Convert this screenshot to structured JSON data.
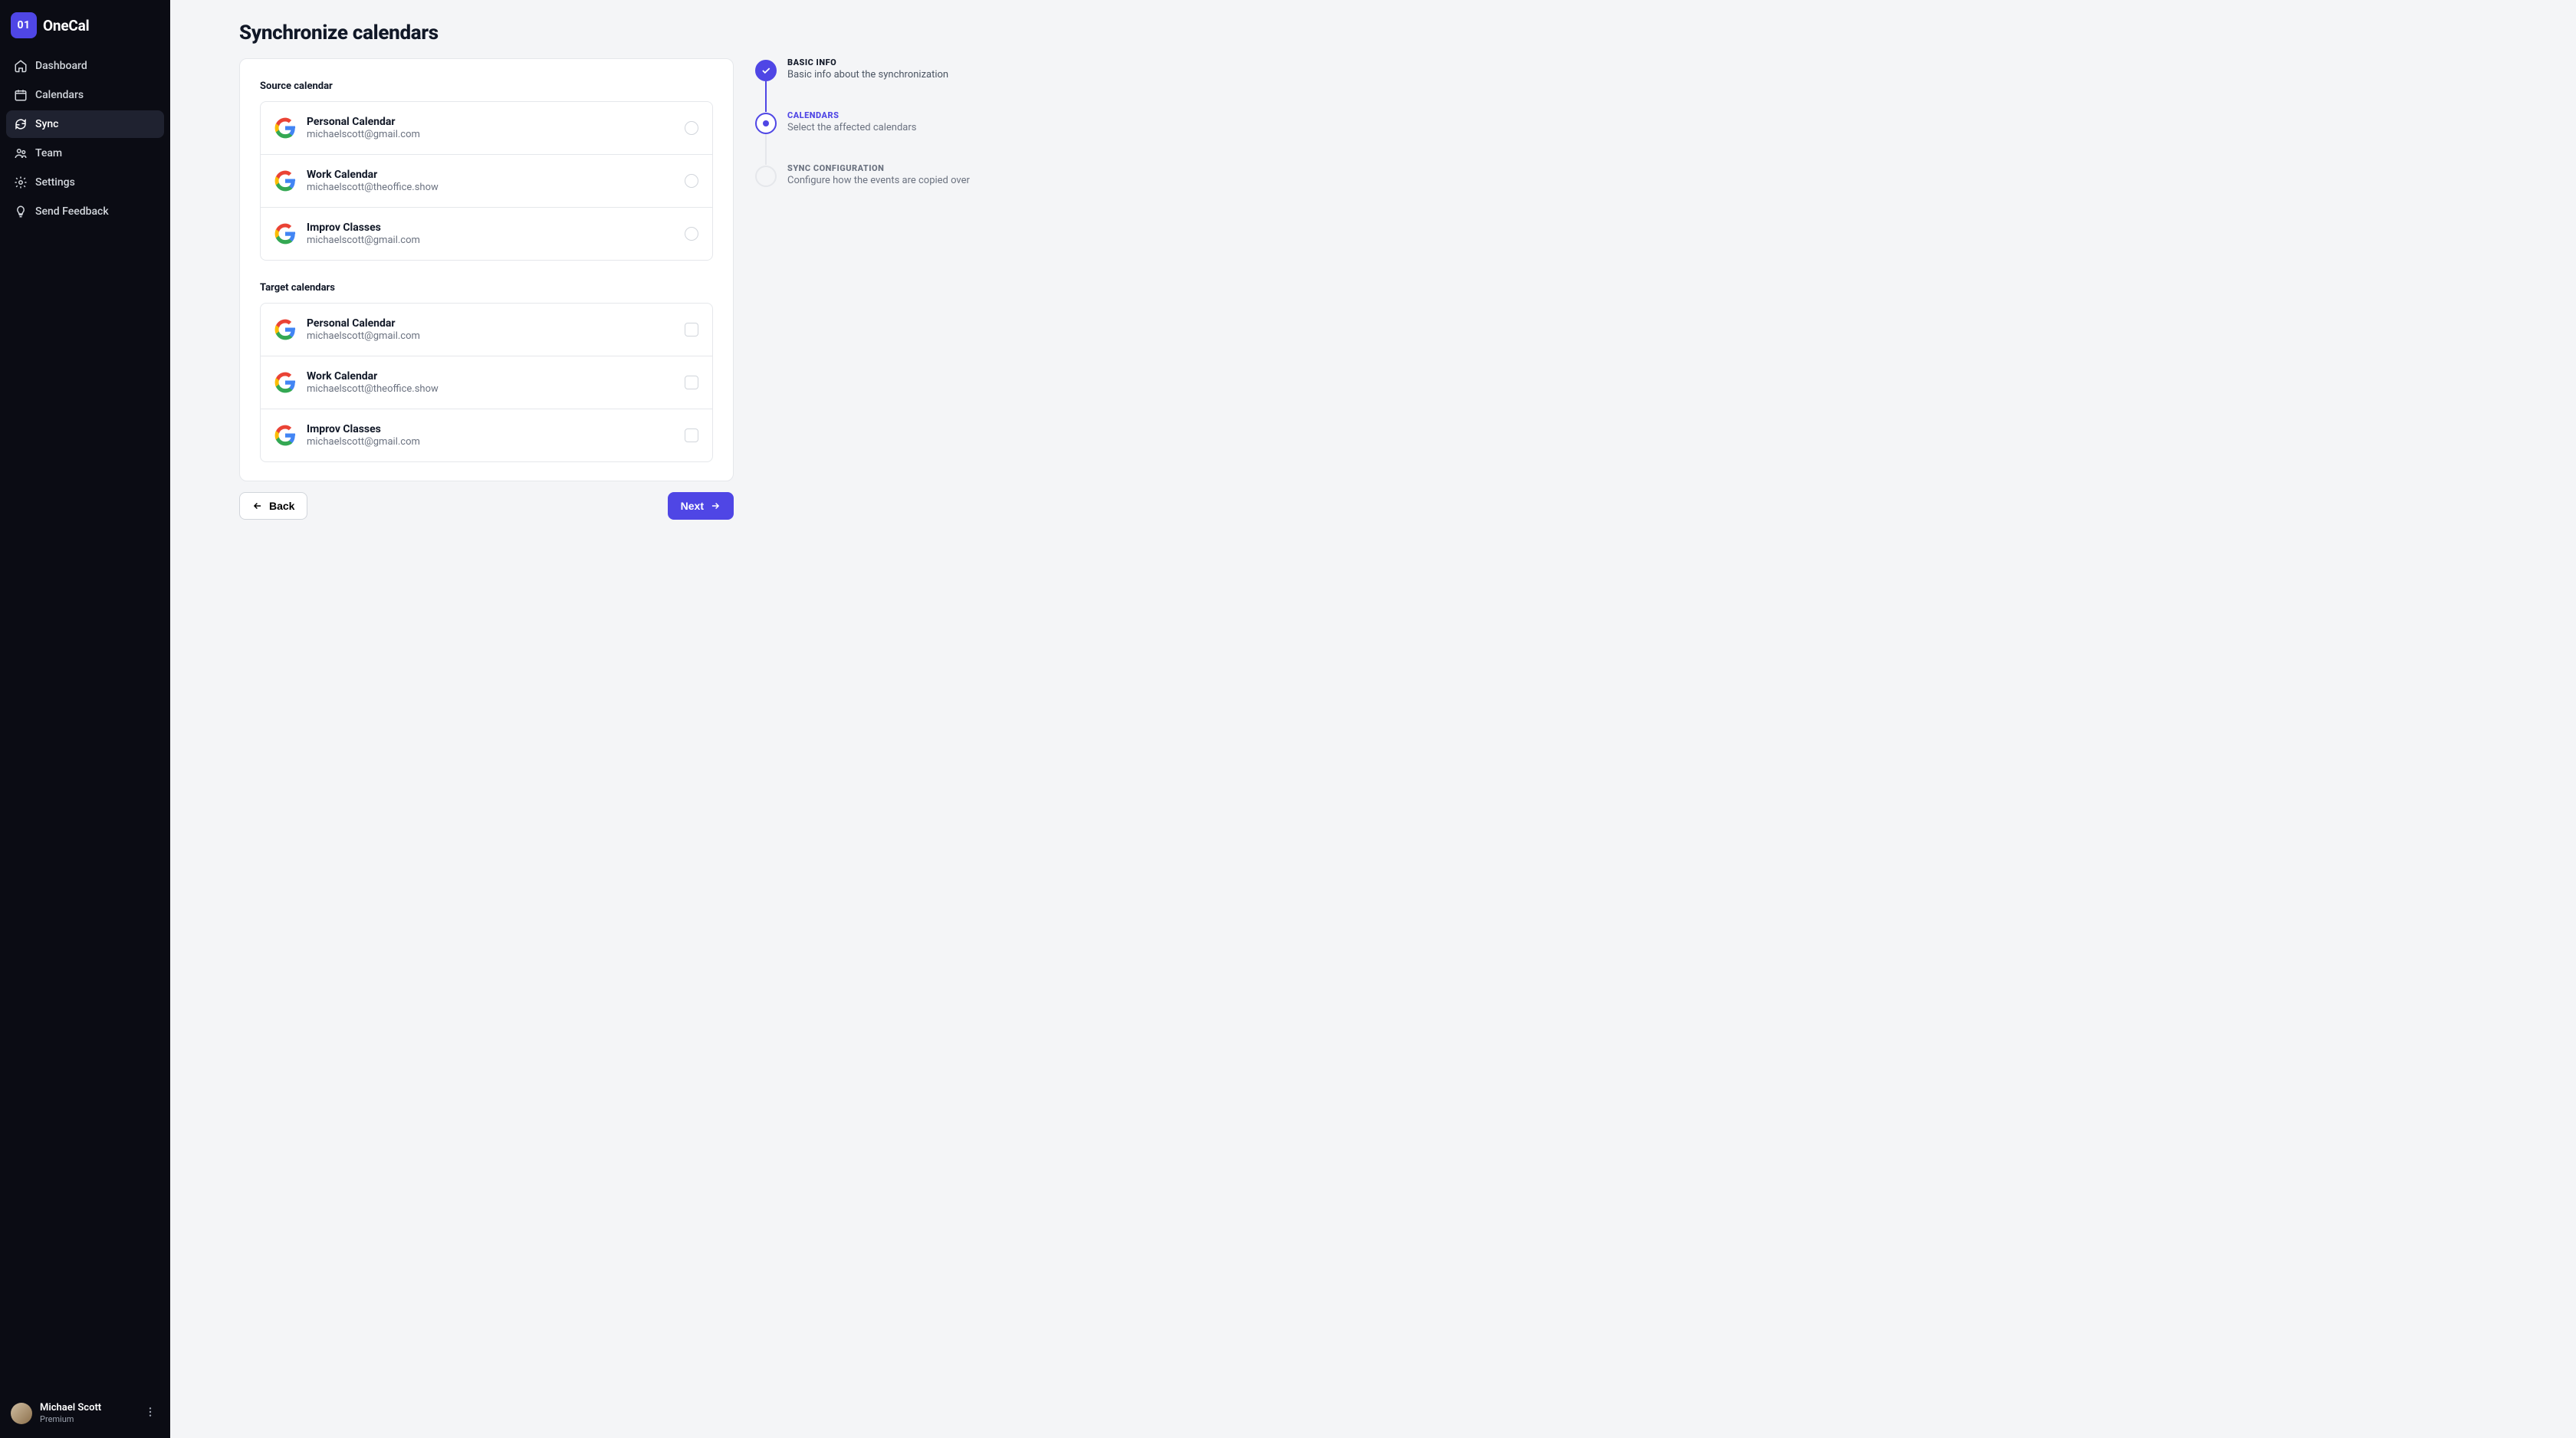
{
  "brand": {
    "mark": "01",
    "name": "OneCal"
  },
  "nav": {
    "items": [
      {
        "label": "Dashboard"
      },
      {
        "label": "Calendars"
      },
      {
        "label": "Sync"
      },
      {
        "label": "Team"
      },
      {
        "label": "Settings"
      },
      {
        "label": "Send Feedback"
      }
    ],
    "active_index": 2
  },
  "user": {
    "name": "Michael Scott",
    "plan": "Premium"
  },
  "page": {
    "title": "Synchronize calendars"
  },
  "source": {
    "heading": "Source calendar",
    "items": [
      {
        "name": "Personal Calendar",
        "email": "michaelscott@gmail.com"
      },
      {
        "name": "Work Calendar",
        "email": "michaelscott@theoffice.show"
      },
      {
        "name": "Improv Classes",
        "email": "michaelscott@gmail.com"
      }
    ]
  },
  "target": {
    "heading": "Target calendars",
    "items": [
      {
        "name": "Personal Calendar",
        "email": "michaelscott@gmail.com"
      },
      {
        "name": "Work Calendar",
        "email": "michaelscott@theoffice.show"
      },
      {
        "name": "Improv Classes",
        "email": "michaelscott@gmail.com"
      }
    ]
  },
  "buttons": {
    "back": "Back",
    "next": "Next"
  },
  "steps": [
    {
      "title": "Basic Info",
      "desc": "Basic info about the synchronization",
      "state": "completed"
    },
    {
      "title": "Calendars",
      "desc": "Select the affected calendars",
      "state": "active"
    },
    {
      "title": "Sync Configuration",
      "desc": "Configure how the events are copied over",
      "state": "upcoming"
    }
  ]
}
